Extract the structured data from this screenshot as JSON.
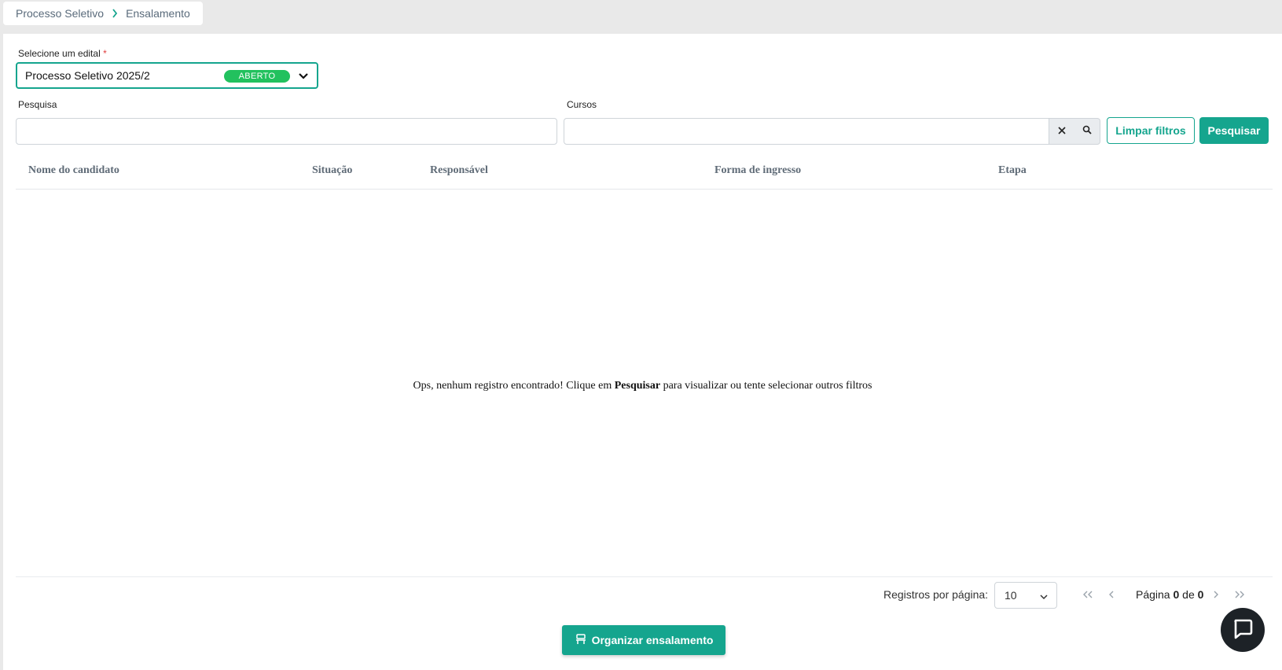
{
  "breadcrumb": {
    "items": [
      "Processo Seletivo",
      "Ensalamento"
    ]
  },
  "edital": {
    "label": "Selecione um edital",
    "required_mark": "*",
    "value": "Processo Seletivo 2025/2",
    "status_badge": "ABERTO"
  },
  "filters": {
    "search_label": "Pesquisa",
    "search_value": "",
    "courses_label": "Cursos",
    "courses_value": "",
    "clear_button": "Limpar filtros",
    "search_button": "Pesquisar"
  },
  "table": {
    "columns": [
      "Nome do candidato",
      "Situação",
      "Responsável",
      "Forma de ingresso",
      "Etapa"
    ],
    "rows": [],
    "empty_prefix": "Ops, nenhum registro encontrado! Clique em ",
    "empty_strong": "Pesquisar",
    "empty_suffix": " para visualizar ou tente selecionar outros filtros"
  },
  "pagination": {
    "per_page_label": "Registros por página:",
    "per_page_value": "10",
    "page_prefix": "Página",
    "current_page": "0",
    "page_sep": "de",
    "total_pages": "0"
  },
  "actions": {
    "organize_button": "Organizar ensalamento"
  },
  "colors": {
    "accent": "#15a58e",
    "badge_open": "#22c15e",
    "chat_button": "#1d2227"
  }
}
